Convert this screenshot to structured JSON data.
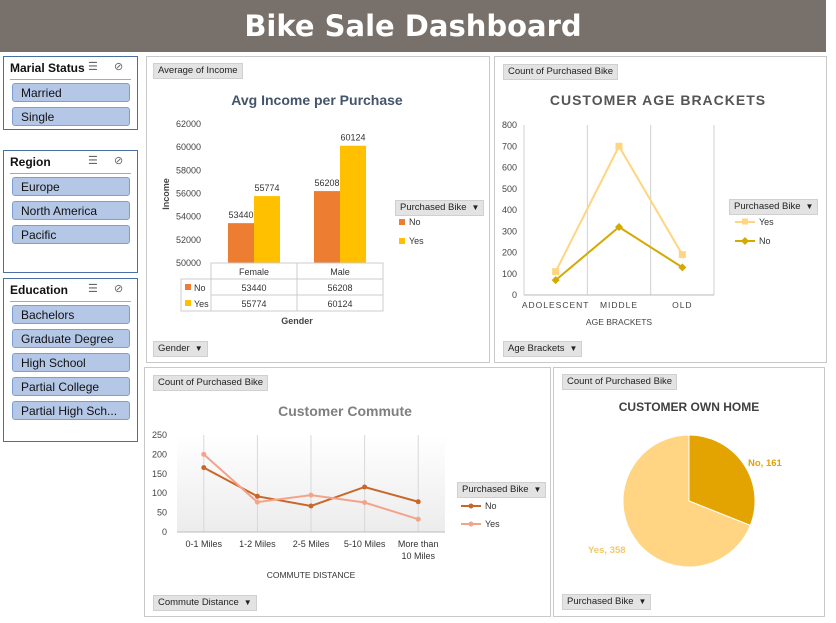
{
  "title": "Bike Sale Dashboard",
  "slicers": [
    {
      "header": "Marial Status",
      "items": [
        "Married",
        "Single"
      ]
    },
    {
      "header": "Region",
      "items": [
        "Europe",
        "North America",
        "Pacific"
      ]
    },
    {
      "header": "Education",
      "items": [
        "Bachelors",
        "Graduate Degree",
        "High School",
        "Partial College",
        "Partial High Sch..."
      ]
    }
  ],
  "income_panel": {
    "field_button": "Average of Income",
    "axis_button": "Gender",
    "legend_button": "Purchased Bike"
  },
  "age_panel": {
    "field_button": "Count of Purchased Bike",
    "axis_button": "Age Brackets",
    "legend_button": "Purchased Bike"
  },
  "commute_panel": {
    "field_button": "Count of Purchased Bike",
    "axis_button": "Commute Distance",
    "legend_button": "Purchased Bike"
  },
  "home_panel": {
    "field_button": "Count of Purchased Bike",
    "axis_button": "Purchased Bike"
  },
  "colors": {
    "no_orange": "#ed7d31",
    "yes_gold": "#ffc000",
    "age_yes": "#ffd580",
    "age_no": "#d4a900",
    "commute_no": "#c9672a",
    "commute_yes": "#f4a38a",
    "pie_no": "#e3a300",
    "pie_yes": "#ffd584"
  },
  "chart_data": [
    {
      "type": "bar",
      "title": "Avg Income per Purchase",
      "xlabel": "Gender",
      "ylabel": "Income",
      "categories": [
        "Female",
        "Male"
      ],
      "series": [
        {
          "name": "No",
          "values": [
            53440,
            56208
          ]
        },
        {
          "name": "Yes",
          "values": [
            55774,
            60124
          ]
        }
      ],
      "ylim": [
        50000,
        62000
      ],
      "yticks": [
        "62000",
        "60000",
        "58000",
        "56000",
        "54000",
        "52000",
        "50000"
      ],
      "data_labels": true,
      "data_table": {
        "rows": [
          {
            "name": "No",
            "values": [
              "53440",
              "56208"
            ]
          },
          {
            "name": "Yes",
            "values": [
              "55774",
              "60124"
            ]
          }
        ]
      },
      "legend": "right"
    },
    {
      "type": "line",
      "title": "CUSTOMER AGE BRACKETS",
      "xlabel": "AGE BRACKETS",
      "categories": [
        "ADOLESCENT",
        "MIDDLE",
        "OLD"
      ],
      "series": [
        {
          "name": "Yes",
          "values": [
            110,
            700,
            190
          ]
        },
        {
          "name": "No",
          "values": [
            70,
            320,
            130
          ]
        }
      ],
      "ylim": [
        0,
        800
      ],
      "yticks": [
        "800",
        "700",
        "600",
        "500",
        "400",
        "300",
        "200",
        "100",
        "0"
      ],
      "legend": "right"
    },
    {
      "type": "line",
      "title": "Customer Commute",
      "xlabel": "COMMUTE DISTANCE",
      "categories": [
        "0-1 Miles",
        "1-2 Miles",
        "2-5 Miles",
        "5-10 Miles",
        "More than 10 Miles"
      ],
      "series": [
        {
          "name": "No",
          "values": [
            166,
            92,
            67,
            116,
            78
          ]
        },
        {
          "name": "Yes",
          "values": [
            200,
            77,
            95,
            76,
            33
          ]
        }
      ],
      "ylim": [
        0,
        250
      ],
      "yticks": [
        "250",
        "200",
        "150",
        "100",
        "50",
        "0"
      ],
      "legend": "right"
    },
    {
      "type": "pie",
      "title": "CUSTOMER OWN HOME",
      "slices": [
        {
          "name": "No",
          "value": 161,
          "label": "No, 161"
        },
        {
          "name": "Yes",
          "value": 358,
          "label": "Yes, 358"
        }
      ]
    }
  ]
}
